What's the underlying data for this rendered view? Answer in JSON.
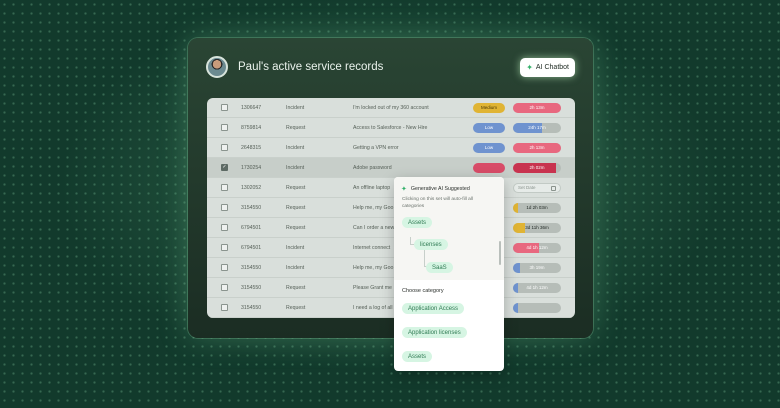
{
  "header": {
    "title": "Paul's active service records",
    "chat_label": "AI Chatbot"
  },
  "icons": {
    "chat": "sparkle-icon",
    "avatar": "user-avatar",
    "calendar": "calendar-icon"
  },
  "colors": {
    "medium": "#e0b434",
    "low": "#6f93cf",
    "high": "#d84c68",
    "accent": "#33b06a"
  },
  "rows": [
    {
      "id": "1306647",
      "type": "Incident",
      "desc": "I'm locked out of my 360 account",
      "checked": false,
      "priority": "Medium",
      "pri_class": "medium",
      "sla": "2h 13m",
      "sla_class": "pink",
      "sla_fill": 1.0
    },
    {
      "id": "8759814",
      "type": "Request",
      "desc": "Access to Salesforce - New Hire",
      "checked": false,
      "priority": "Low",
      "pri_class": "low",
      "sla": "24h 17m",
      "sla_class": "blue",
      "sla_fill": 0.6
    },
    {
      "id": "2648315",
      "type": "Incident",
      "desc": "Getting a VPN error",
      "checked": false,
      "priority": "Low",
      "pri_class": "low",
      "sla": "2h 13m",
      "sla_class": "pink",
      "sla_fill": 1.0
    },
    {
      "id": "1730254",
      "type": "Incident",
      "desc": "Adobe password",
      "checked": true,
      "priority": "",
      "pri_class": "high",
      "sla": "2h 02m",
      "sla_class": "red",
      "sla_fill": 0.9
    },
    {
      "id": "1302052",
      "type": "Request",
      "desc": "An offline laptop",
      "checked": false,
      "priority": "",
      "pri_class": "",
      "sla": "Set Date",
      "sla_class": "setdate",
      "sla_fill": 0
    },
    {
      "id": "3154550",
      "type": "Request",
      "desc": "Help me, my Goo",
      "checked": false,
      "priority": "",
      "pri_class": "",
      "sla": "1d 2h 03m",
      "sla_class": "yellow",
      "sla_fill": 0.1
    },
    {
      "id": "6794501",
      "type": "Request",
      "desc": "Can I order a new",
      "checked": false,
      "priority": "",
      "pri_class": "",
      "sla": "3d 11h 36m",
      "sla_class": "yellow",
      "sla_fill": 0.25
    },
    {
      "id": "6794501",
      "type": "Incident",
      "desc": "Internet connect",
      "checked": false,
      "priority": "",
      "pri_class": "",
      "sla": "4d 1h 12m",
      "sla_class": "pink",
      "sla_fill": 0.55
    },
    {
      "id": "3154550",
      "type": "Incident",
      "desc": "Help me, my Goo",
      "checked": false,
      "priority": "",
      "pri_class": "",
      "sla": "3h 19m",
      "sla_class": "blue",
      "sla_fill": 0.15
    },
    {
      "id": "3154550",
      "type": "Request",
      "desc": "Please Grant me",
      "checked": false,
      "priority": "",
      "pri_class": "",
      "sla": "4d 1h 12m",
      "sla_class": "blue",
      "sla_fill": 0.1
    },
    {
      "id": "3154550",
      "type": "Request",
      "desc": "I need a log of all",
      "checked": false,
      "priority": "",
      "pri_class": "",
      "sla": "",
      "sla_class": "blue",
      "sla_fill": 0.1
    }
  ],
  "popup": {
    "heading": "Generative AI Suggested",
    "subtext": "Clicking on this set will auto-fill all categories",
    "suggested": [
      "Assets",
      "licenses",
      "SaaS"
    ],
    "choose_label": "Choose category",
    "options": [
      "Application Access",
      "Application licenses",
      "Assets"
    ]
  }
}
